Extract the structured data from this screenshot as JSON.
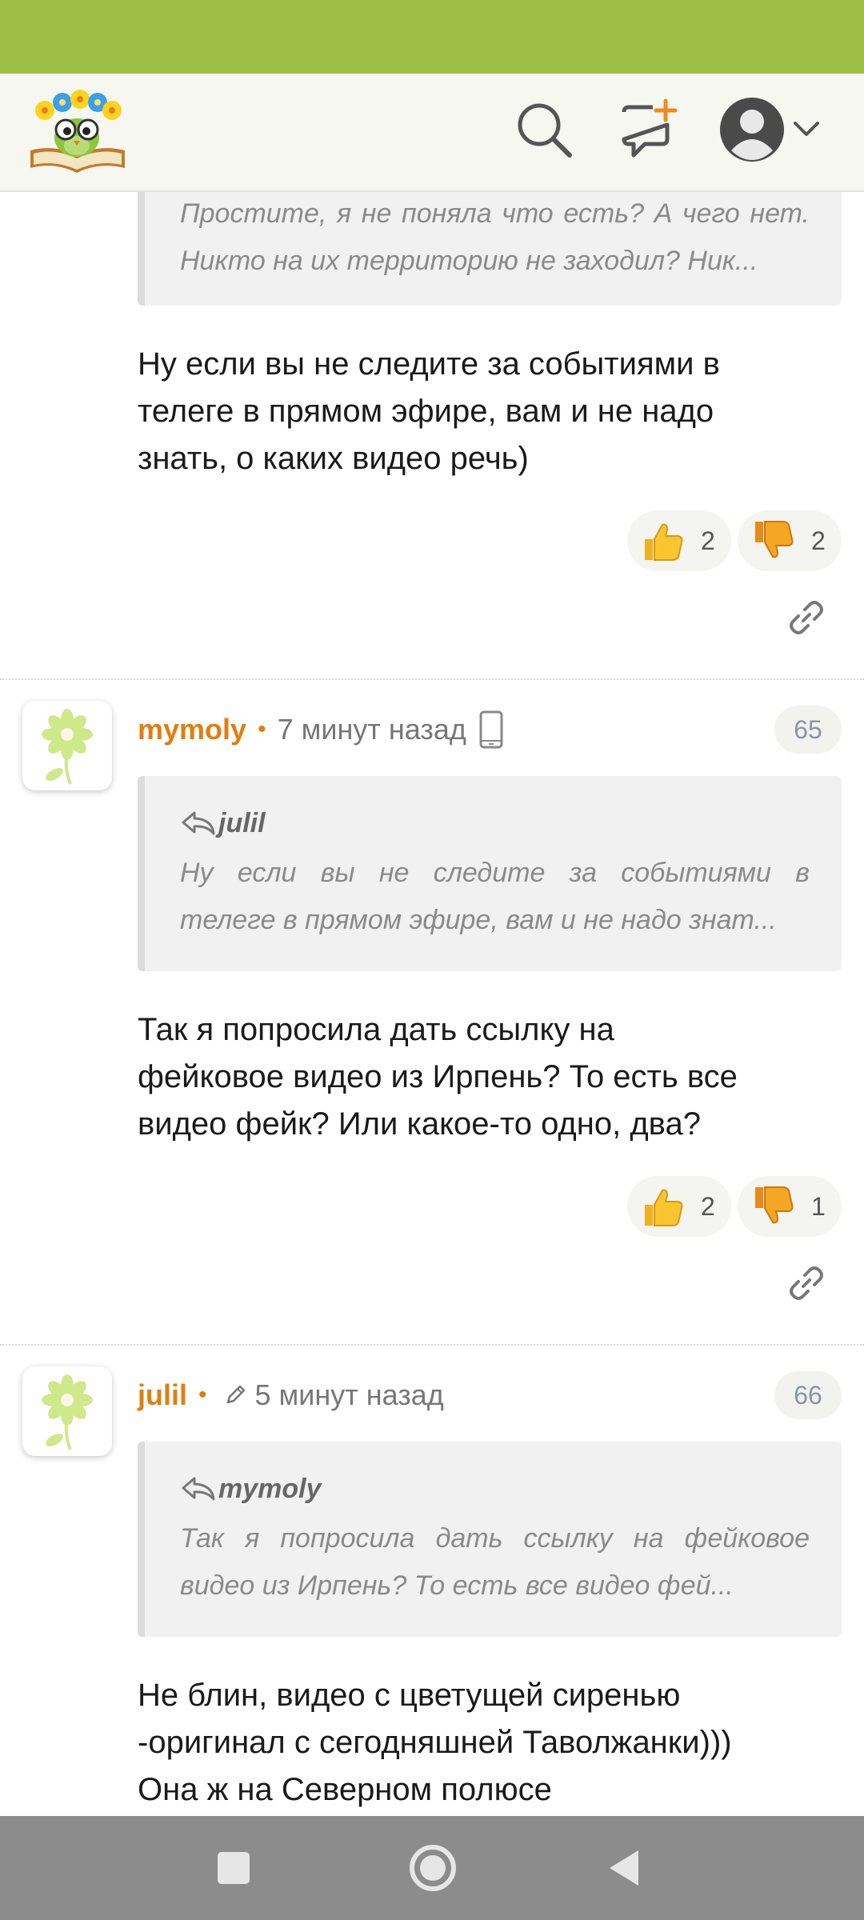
{
  "header": {
    "logo_icon": "owl-on-book-logo",
    "icons": [
      "search-icon",
      "new-post-icon",
      "account-avatar-icon",
      "chevron-down-icon"
    ]
  },
  "colors": {
    "status_bar": "#9dc044",
    "username": "#e07f10",
    "header_bg": "#f7f7f2"
  },
  "comments": [
    {
      "quote": {
        "lines": [
          "Простите, я не поняла что есть? А чего нет.",
          "Никто на их территорию не заходил? Ник..."
        ]
      },
      "body": [
        "Ну если вы не следите за событиями в",
        "телеге в прямом эфире, вам и не надо",
        "знать, о каких видео речь)"
      ],
      "likes": "2",
      "dislikes": "2"
    },
    {
      "author": "mymoly",
      "time": "7 минут назад",
      "number": "65",
      "quote": {
        "author": "julil",
        "lines": [
          "Ну если вы не следите за событиями в",
          "телеге в прямом эфире, вам и не надо знат..."
        ]
      },
      "body": [
        "Так я попросила дать ссылку на",
        "фейковое видео из Ирпень? То есть все",
        "видео фейк? Или какое-то одно, два?"
      ],
      "likes": "2",
      "dislikes": "1"
    },
    {
      "author": "julil",
      "time": "5 минут назад",
      "number": "66",
      "quote": {
        "author": "mymoly",
        "lines": [
          "Так я попросила дать ссылку на фейковое",
          "видео из Ирпень? То есть все видео фей..."
        ]
      },
      "body": [
        "Не блин, видео с цветущей сиренью",
        "-оригинал с сегодняшней Таволжанки)))",
        "Она ж на Северном полюсе"
      ]
    }
  ],
  "nav": [
    "recents-button",
    "home-button",
    "back-button"
  ]
}
